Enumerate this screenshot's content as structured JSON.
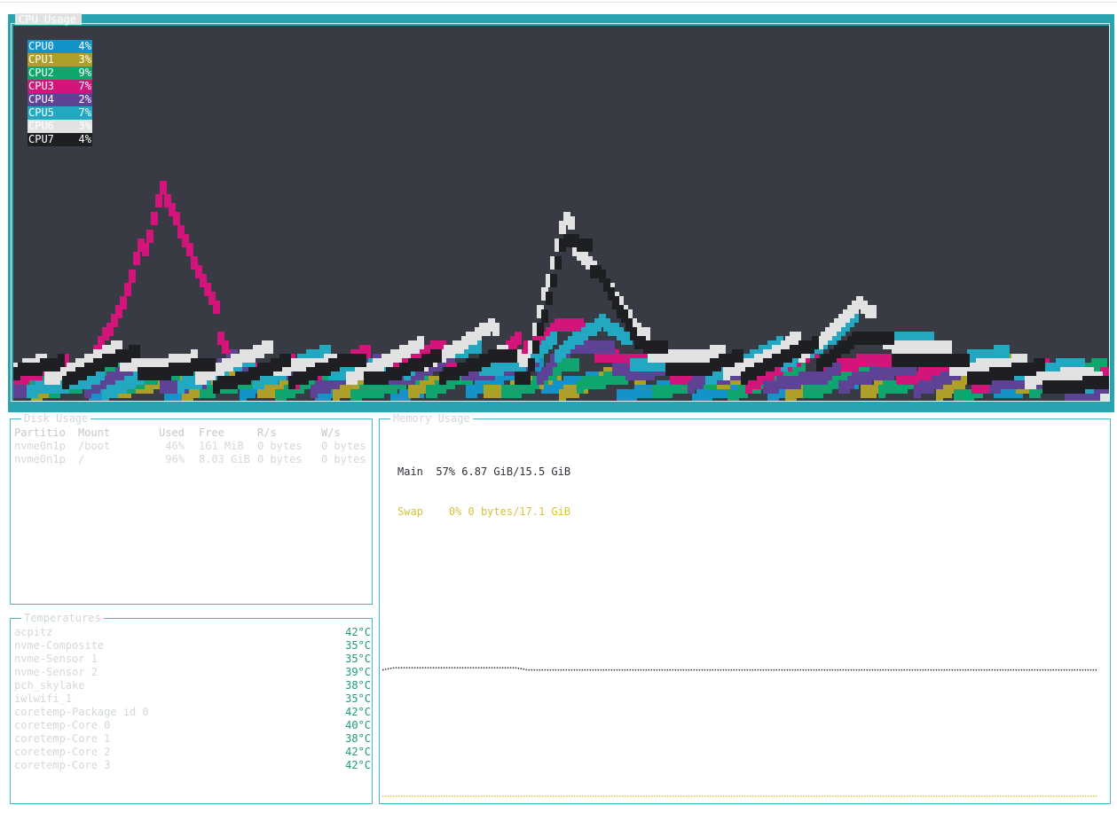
{
  "cpu_panel": {
    "title": "CPU Usage",
    "legend": [
      {
        "name": "CPU0",
        "value": "4%",
        "color": "#1593c8",
        "text": "#ffffff"
      },
      {
        "name": "CPU1",
        "value": "3%",
        "color": "#ae9f28",
        "text": "#ffffff"
      },
      {
        "name": "CPU2",
        "value": "9%",
        "color": "#10a46e",
        "text": "#ffffff"
      },
      {
        "name": "CPU3",
        "value": "7%",
        "color": "#d3157b",
        "text": "#ffffff"
      },
      {
        "name": "CPU4",
        "value": "2%",
        "color": "#5e4296",
        "text": "#ffffff"
      },
      {
        "name": "CPU5",
        "value": "7%",
        "color": "#22a8c0",
        "text": "#ffffff"
      },
      {
        "name": "CPU6",
        "value": "3%",
        "color": "#e2e2e2",
        "text": "#ffffff"
      },
      {
        "name": "CPU7",
        "value": "4%",
        "color": "#1e1f22",
        "text": "#ffffff"
      }
    ]
  },
  "chart_data": {
    "type": "line",
    "title": "CPU Usage",
    "ylim": [
      0,
      100
    ],
    "grid": false,
    "legend_placement": "top-left",
    "series": [
      {
        "name": "CPU0",
        "color": "#1593c8",
        "values": [
          7,
          6,
          5,
          6,
          5,
          4,
          6,
          7,
          6,
          5,
          4,
          5,
          6,
          8,
          9,
          7,
          6,
          5,
          4,
          5,
          4,
          6,
          7,
          9,
          12,
          10,
          8,
          6,
          5,
          4,
          4
        ]
      },
      {
        "name": "CPU1",
        "color": "#ae9f28",
        "values": [
          5,
          6,
          7,
          6,
          5,
          6,
          8,
          6,
          5,
          6,
          5,
          7,
          8,
          6,
          5,
          6,
          7,
          10,
          12,
          9,
          8,
          6,
          5,
          7,
          6,
          5,
          8,
          10,
          6,
          5,
          3
        ]
      },
      {
        "name": "CPU2",
        "color": "#10a46e",
        "values": [
          6,
          7,
          6,
          8,
          9,
          7,
          6,
          5,
          7,
          6,
          5,
          6,
          8,
          7,
          6,
          9,
          8,
          7,
          6,
          5,
          6,
          7,
          6,
          8,
          7,
          6,
          5,
          6,
          7,
          8,
          9
        ]
      },
      {
        "name": "CPU3",
        "color": "#d3157b",
        "values": [
          8,
          9,
          12,
          28,
          60,
          34,
          12,
          9,
          10,
          11,
          13,
          14,
          12,
          10,
          18,
          22,
          16,
          12,
          10,
          9,
          8,
          11,
          13,
          12,
          10,
          9,
          8,
          7,
          8,
          7,
          7
        ]
      },
      {
        "name": "CPU4",
        "color": "#5e4296",
        "values": [
          6,
          5,
          7,
          9,
          8,
          6,
          11,
          9,
          7,
          8,
          10,
          9,
          12,
          10,
          8,
          16,
          14,
          10,
          8,
          9,
          7,
          8,
          6,
          9,
          8,
          7,
          9,
          8,
          6,
          4,
          2
        ]
      },
      {
        "name": "CPU5",
        "color": "#22a8c0",
        "values": [
          8,
          6,
          5,
          7,
          9,
          8,
          10,
          9,
          12,
          11,
          10,
          13,
          14,
          12,
          11,
          18,
          22,
          13,
          11,
          10,
          12,
          14,
          16,
          21,
          18,
          15,
          13,
          12,
          10,
          9,
          7
        ]
      },
      {
        "name": "CPU6",
        "color": "#e2e2e2",
        "values": [
          9,
          10,
          12,
          14,
          11,
          10,
          12,
          13,
          11,
          10,
          12,
          14,
          16,
          19,
          13,
          48,
          36,
          18,
          14,
          12,
          12,
          14,
          19,
          26,
          18,
          14,
          12,
          10,
          9,
          8,
          3
        ]
      },
      {
        "name": "CPU7",
        "color": "#1e1f22",
        "values": [
          10,
          9,
          11,
          12,
          10,
          9,
          8,
          9,
          10,
          11,
          9,
          10,
          11,
          12,
          10,
          44,
          38,
          16,
          12,
          10,
          11,
          13,
          14,
          18,
          15,
          12,
          10,
          9,
          8,
          6,
          4
        ]
      }
    ]
  },
  "disk_panel": {
    "title": "Disk Usage",
    "headers": [
      "Partitio",
      "Mount",
      "Used",
      "Free",
      "R/s",
      "W/s"
    ],
    "rows": [
      [
        "nvme0n1p",
        "/boot",
        "46%",
        "161 MiB",
        "0 bytes",
        "0 bytes"
      ],
      [
        "nvme0n1p",
        "/",
        "96%",
        "8.03 GiB",
        "0 bytes",
        "0 bytes"
      ]
    ]
  },
  "temp_panel": {
    "title": "Temperatures",
    "rows": [
      {
        "name": "acpitz",
        "value": "42°C"
      },
      {
        "name": "nvme-Composite",
        "value": "35°C"
      },
      {
        "name": "nvme-Sensor 1",
        "value": "35°C"
      },
      {
        "name": "nvme-Sensor 2",
        "value": "39°C"
      },
      {
        "name": "pch_skylake",
        "value": "38°C"
      },
      {
        "name": "iwlwifi_1",
        "value": "35°C"
      },
      {
        "name": "coretemp-Package id 0",
        "value": "42°C"
      },
      {
        "name": "coretemp-Core 0",
        "value": "40°C"
      },
      {
        "name": "coretemp-Core 1",
        "value": "38°C"
      },
      {
        "name": "coretemp-Core 2",
        "value": "42°C"
      },
      {
        "name": "coretemp-Core 3",
        "value": "42°C"
      }
    ]
  },
  "mem_panel": {
    "title": "Memory Usage",
    "main": {
      "label": "Main",
      "percent": "57%",
      "detail": "6.87 GiB/15.5 GiB",
      "color": "#2d3138"
    },
    "swap": {
      "label": "Swap",
      "percent": "0%",
      "detail": "0 bytes/17.1 GiB",
      "color": "#d8c23c"
    },
    "chart_data": {
      "type": "line",
      "ylim": [
        0,
        100
      ],
      "series": [
        {
          "name": "Main",
          "color": "#2d3138",
          "values": [
            57,
            58,
            58,
            58,
            58,
            58,
            58,
            58,
            58,
            58,
            58,
            58,
            57,
            57,
            57,
            57,
            57,
            57,
            57,
            57,
            57,
            57,
            57,
            57,
            57,
            57,
            57,
            57,
            57,
            57,
            57,
            57,
            57,
            57,
            57,
            57,
            57,
            57,
            57,
            57,
            57,
            57,
            57,
            57,
            57,
            57,
            57,
            57,
            57,
            57,
            57,
            57,
            57,
            57,
            57,
            57,
            57,
            57,
            57,
            57
          ]
        },
        {
          "name": "Swap",
          "color": "#d8c23c",
          "values": [
            0,
            0,
            0,
            0,
            0,
            0,
            0,
            0,
            0,
            0,
            0,
            0,
            0,
            0,
            0,
            0,
            0,
            0,
            0,
            0,
            0,
            0,
            0,
            0,
            0,
            0,
            0,
            0,
            0,
            0,
            0,
            0,
            0,
            0,
            0,
            0,
            0,
            0,
            0,
            0,
            0,
            0,
            0,
            0,
            0,
            0,
            0,
            0,
            0,
            0,
            0,
            0,
            0,
            0,
            0,
            0,
            0,
            0,
            0,
            0
          ]
        }
      ]
    }
  }
}
